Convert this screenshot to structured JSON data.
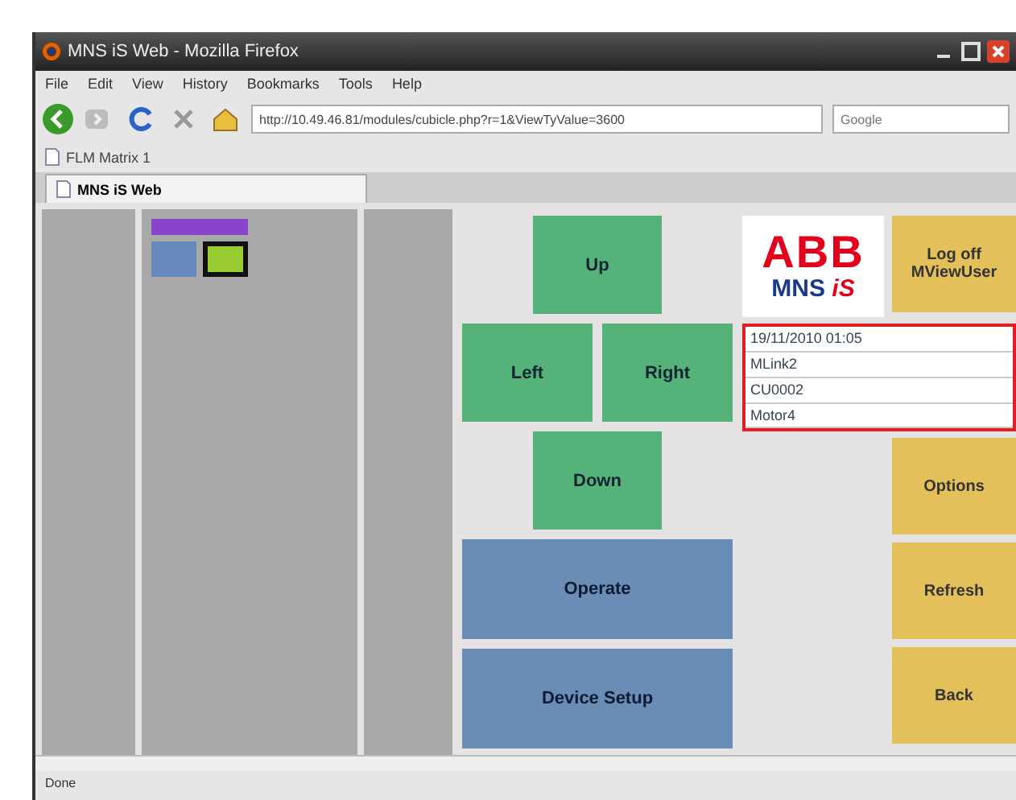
{
  "window": {
    "title": "MNS iS Web - Mozilla Firefox"
  },
  "menu": [
    "File",
    "Edit",
    "View",
    "History",
    "Bookmarks",
    "Tools",
    "Help"
  ],
  "address": {
    "value": "http://10.49.46.81/modules/cubicle.php?r=1&ViewTyValue=3600"
  },
  "search": {
    "placeholder": "Google"
  },
  "bookmarks": [
    "FLM Matrix 1"
  ],
  "tabs": [
    {
      "label": "MNS iS Web",
      "selected": true
    }
  ],
  "cubicles": [
    {
      "kind": "bar",
      "color": "#8844cc",
      "selected": false
    },
    {
      "kind": "block",
      "color": "#6688bb",
      "selected": false
    },
    {
      "kind": "block",
      "color": "#99cc33",
      "selected": true
    }
  ],
  "nav_buttons": {
    "up": "Up",
    "left": "Left",
    "right": "Right",
    "down": "Down"
  },
  "actions": [
    "Operate",
    "Device Setup"
  ],
  "logo": {
    "brand": "ABB",
    "product": "MNS",
    "suffix": "iS"
  },
  "info": [
    "19/11/2010 01:05",
    "MLink2",
    "CU0002",
    "Motor4"
  ],
  "side_buttons": [
    {
      "label": "Log off\nMViewUser"
    },
    {
      "label": "Options"
    },
    {
      "label": "Refresh"
    },
    {
      "label": "Back"
    }
  ],
  "status_bar": "Done"
}
